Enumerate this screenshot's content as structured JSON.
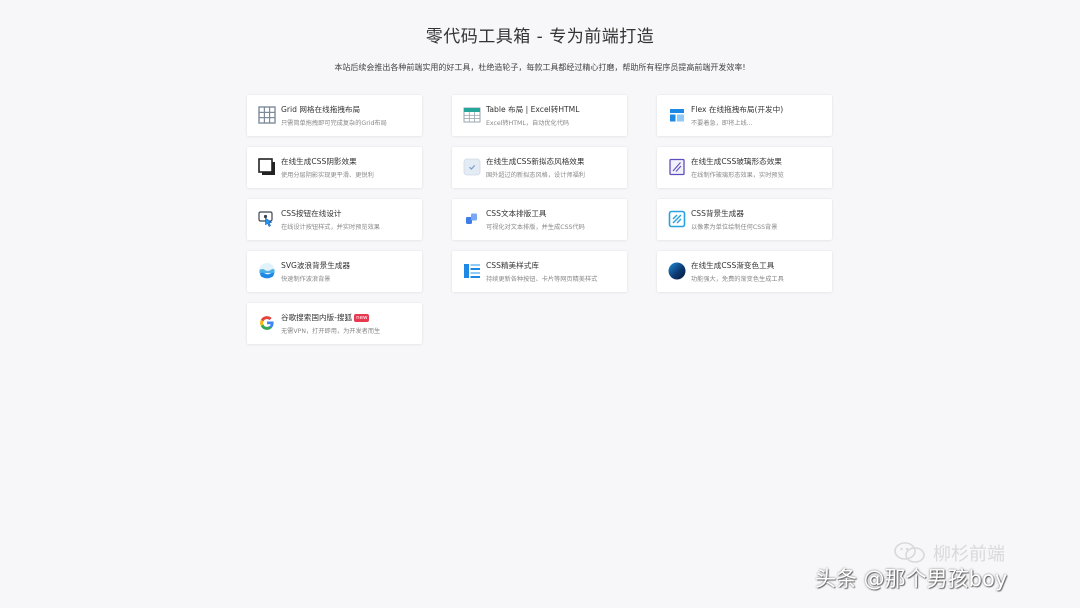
{
  "header": {
    "title": "零代码工具箱 - 专为前端打造",
    "subtitle": "本站后续会推出各种前端实用的好工具，杜绝造轮子，每款工具都经过精心打磨，帮助所有程序员提高前端开发效率!"
  },
  "tools": [
    {
      "name": "Grid 网格在线拖拽布局",
      "desc": "只需简单拖拽即可完成复杂的Grid布局",
      "icon": "grid-icon"
    },
    {
      "name": "Table 布局 | Excel转HTML",
      "desc": "Excel转HTML，自动优化代码",
      "icon": "table-icon"
    },
    {
      "name": "Flex 在线拖拽布局(开发中)",
      "desc": "不要着急，即将上线...",
      "icon": "flex-layout-icon"
    },
    {
      "name": "在线生成CSS阴影效果",
      "desc": "使用分层阴影实现更平滑、更锐利",
      "icon": "shadow-icon"
    },
    {
      "name": "在线生成CSS新拟态风格效果",
      "desc": "国外超过的新拟态风格，设计师福利",
      "icon": "neumorphism-icon"
    },
    {
      "name": "在线生成CSS玻璃形态效果",
      "desc": "在线制作玻璃形态效果，实时预览",
      "icon": "glass-icon"
    },
    {
      "name": "CSS按钮在线设计",
      "desc": "在线设计按钮样式，并实时预览效果",
      "icon": "button-design-icon"
    },
    {
      "name": "CSS文本排版工具",
      "desc": "可视化对文本排版，并生成CSS代码",
      "icon": "text-typography-icon"
    },
    {
      "name": "CSS背景生成器",
      "desc": "以像素为单位绘制任何CSS背景",
      "icon": "background-icon"
    },
    {
      "name": "SVG波浪背景生成器",
      "desc": "快速制作波浪背景",
      "icon": "wave-icon"
    },
    {
      "name": "CSS精美样式库",
      "desc": "持续更新各种按钮、卡片等网页精美样式",
      "icon": "style-library-icon"
    },
    {
      "name": "在线生成CSS渐变色工具",
      "desc": "功能强大，免费的渐变色生成工具",
      "icon": "gradient-icon"
    },
    {
      "name": "谷歌搜索国内版-搜狐",
      "desc": "无需VPN，打开即用，为开发者而生",
      "icon": "google-icon",
      "badge": "new"
    }
  ],
  "watermarks": {
    "account": "柳杉前端",
    "author": "头条 @那个男孩boy"
  },
  "colors": {
    "page_bg": "#f7f7f9",
    "card_bg": "#ffffff",
    "badge_bg": "#e8384f",
    "accent_blue": "#1e88e5",
    "accent_teal": "#26a69a"
  }
}
